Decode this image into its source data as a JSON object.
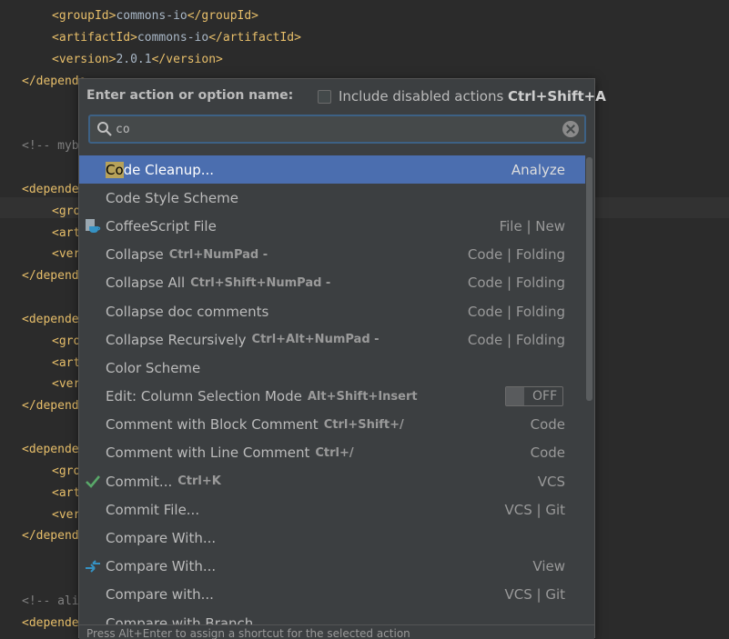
{
  "editor": {
    "lines": [
      {
        "indent": 1,
        "open": "<groupId>",
        "text": "commons-io",
        "close": "</groupId>"
      },
      {
        "indent": 1,
        "open": "<artifactId>",
        "text": "commons-io",
        "close": "</artifactId>"
      },
      {
        "indent": 1,
        "open": "<version>",
        "text": "2.0.1",
        "close": "</version>"
      },
      {
        "indent": 0,
        "open": "</depende",
        "text": "",
        "close": ""
      },
      {
        "indent": 0,
        "open": "",
        "text": "",
        "close": ""
      },
      {
        "indent": 0,
        "open": "",
        "text": "",
        "close": ""
      },
      {
        "indent": 0,
        "comment": "<!-- myb"
      },
      {
        "indent": 0,
        "open": "",
        "text": "",
        "close": ""
      },
      {
        "indent": 0,
        "open": "<depende",
        "text": "",
        "close": ""
      },
      {
        "indent": 1,
        "open": "<gro",
        "text": "",
        "close": ""
      },
      {
        "indent": 1,
        "open": "<art",
        "text": "",
        "close": ""
      },
      {
        "indent": 1,
        "open": "<ver",
        "text": "",
        "close": ""
      },
      {
        "indent": 0,
        "open": "</depend",
        "text": "",
        "close": ""
      },
      {
        "indent": 0,
        "open": "",
        "text": "",
        "close": ""
      },
      {
        "indent": 0,
        "open": "<depende",
        "text": "",
        "close": ""
      },
      {
        "indent": 1,
        "open": "<gro",
        "text": "",
        "close": ""
      },
      {
        "indent": 1,
        "open": "<art",
        "text": "",
        "close": ""
      },
      {
        "indent": 1,
        "open": "<ver",
        "text": "",
        "close": ""
      },
      {
        "indent": 0,
        "open": "</depend",
        "text": "",
        "close": ""
      },
      {
        "indent": 0,
        "open": "",
        "text": "",
        "close": ""
      },
      {
        "indent": 0,
        "open": "<depende",
        "text": "",
        "close": ""
      },
      {
        "indent": 1,
        "open": "<gro",
        "text": "",
        "close": ""
      },
      {
        "indent": 1,
        "open": "<art",
        "text": "",
        "close": ""
      },
      {
        "indent": 1,
        "open": "<ver",
        "text": "",
        "close": ""
      },
      {
        "indent": 0,
        "open": "</depend",
        "text": "",
        "close": ""
      },
      {
        "indent": 0,
        "open": "",
        "text": "",
        "close": ""
      },
      {
        "indent": 0,
        "open": "",
        "text": "",
        "close": ""
      },
      {
        "indent": 0,
        "comment": "<!-- ali"
      },
      {
        "indent": 0,
        "open": "<depende",
        "text": "",
        "close": ""
      }
    ]
  },
  "popup": {
    "header_label": "Enter action or option name:",
    "include_disabled_label": "Include disabled actions",
    "include_disabled_shortcut": "Ctrl+Shift+A",
    "search_value": "co",
    "footer": "Press Alt+Enter to assign a shortcut for the selected action",
    "toggle_text": "OFF",
    "items": [
      {
        "name": "Code Cleanup...",
        "shortcut": "",
        "group": "Analyze",
        "icon": "",
        "selected": true,
        "highlight": "Co"
      },
      {
        "name": "Code Style Scheme",
        "shortcut": "",
        "group": "",
        "icon": ""
      },
      {
        "name": "CoffeeScript File",
        "shortcut": "",
        "group": "File | New",
        "icon": "coffeescript-file-icon"
      },
      {
        "name": "Collapse",
        "shortcut": "Ctrl+NumPad -",
        "group": "Code | Folding",
        "icon": ""
      },
      {
        "name": "Collapse All",
        "shortcut": "Ctrl+Shift+NumPad -",
        "group": "Code | Folding",
        "icon": ""
      },
      {
        "name": "Collapse doc comments",
        "shortcut": "",
        "group": "Code | Folding",
        "icon": ""
      },
      {
        "name": "Collapse Recursively",
        "shortcut": "Ctrl+Alt+NumPad -",
        "group": "Code | Folding",
        "icon": ""
      },
      {
        "name": "Color Scheme",
        "shortcut": "",
        "group": "",
        "icon": ""
      },
      {
        "name": "Edit: Column Selection Mode",
        "shortcut": "Alt+Shift+Insert",
        "group": "",
        "icon": "",
        "toggle": true
      },
      {
        "name": "Comment with Block Comment",
        "shortcut": "Ctrl+Shift+/",
        "group": "Code",
        "icon": ""
      },
      {
        "name": "Comment with Line Comment",
        "shortcut": "Ctrl+/",
        "group": "Code",
        "icon": ""
      },
      {
        "name": "Commit...",
        "shortcut": "Ctrl+K",
        "group": "VCS",
        "icon": "checkmark-icon"
      },
      {
        "name": "Commit File...",
        "shortcut": "",
        "group": "VCS | Git",
        "icon": ""
      },
      {
        "name": "Compare With...",
        "shortcut": "",
        "group": "",
        "icon": ""
      },
      {
        "name": "Compare With...",
        "shortcut": "",
        "group": "View",
        "icon": "compare-arrows-icon"
      },
      {
        "name": "Compare with...",
        "shortcut": "",
        "group": "VCS | Git",
        "icon": ""
      },
      {
        "name": "Compare with Branch...",
        "shortcut": "",
        "group": "",
        "icon": ""
      }
    ]
  }
}
